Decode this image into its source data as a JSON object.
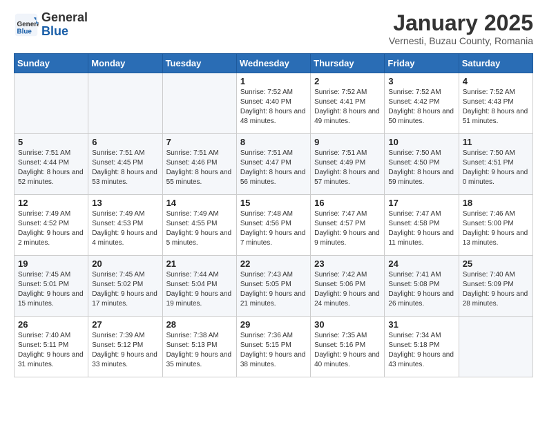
{
  "logo": {
    "general": "General",
    "blue": "Blue"
  },
  "title": "January 2025",
  "location": "Vernesti, Buzau County, Romania",
  "weekdays": [
    "Sunday",
    "Monday",
    "Tuesday",
    "Wednesday",
    "Thursday",
    "Friday",
    "Saturday"
  ],
  "weeks": [
    [
      {
        "day": "",
        "info": ""
      },
      {
        "day": "",
        "info": ""
      },
      {
        "day": "",
        "info": ""
      },
      {
        "day": "1",
        "info": "Sunrise: 7:52 AM\nSunset: 4:40 PM\nDaylight: 8 hours and 48 minutes."
      },
      {
        "day": "2",
        "info": "Sunrise: 7:52 AM\nSunset: 4:41 PM\nDaylight: 8 hours and 49 minutes."
      },
      {
        "day": "3",
        "info": "Sunrise: 7:52 AM\nSunset: 4:42 PM\nDaylight: 8 hours and 50 minutes."
      },
      {
        "day": "4",
        "info": "Sunrise: 7:52 AM\nSunset: 4:43 PM\nDaylight: 8 hours and 51 minutes."
      }
    ],
    [
      {
        "day": "5",
        "info": "Sunrise: 7:51 AM\nSunset: 4:44 PM\nDaylight: 8 hours and 52 minutes."
      },
      {
        "day": "6",
        "info": "Sunrise: 7:51 AM\nSunset: 4:45 PM\nDaylight: 8 hours and 53 minutes."
      },
      {
        "day": "7",
        "info": "Sunrise: 7:51 AM\nSunset: 4:46 PM\nDaylight: 8 hours and 55 minutes."
      },
      {
        "day": "8",
        "info": "Sunrise: 7:51 AM\nSunset: 4:47 PM\nDaylight: 8 hours and 56 minutes."
      },
      {
        "day": "9",
        "info": "Sunrise: 7:51 AM\nSunset: 4:49 PM\nDaylight: 8 hours and 57 minutes."
      },
      {
        "day": "10",
        "info": "Sunrise: 7:50 AM\nSunset: 4:50 PM\nDaylight: 8 hours and 59 minutes."
      },
      {
        "day": "11",
        "info": "Sunrise: 7:50 AM\nSunset: 4:51 PM\nDaylight: 9 hours and 0 minutes."
      }
    ],
    [
      {
        "day": "12",
        "info": "Sunrise: 7:49 AM\nSunset: 4:52 PM\nDaylight: 9 hours and 2 minutes."
      },
      {
        "day": "13",
        "info": "Sunrise: 7:49 AM\nSunset: 4:53 PM\nDaylight: 9 hours and 4 minutes."
      },
      {
        "day": "14",
        "info": "Sunrise: 7:49 AM\nSunset: 4:55 PM\nDaylight: 9 hours and 5 minutes."
      },
      {
        "day": "15",
        "info": "Sunrise: 7:48 AM\nSunset: 4:56 PM\nDaylight: 9 hours and 7 minutes."
      },
      {
        "day": "16",
        "info": "Sunrise: 7:47 AM\nSunset: 4:57 PM\nDaylight: 9 hours and 9 minutes."
      },
      {
        "day": "17",
        "info": "Sunrise: 7:47 AM\nSunset: 4:58 PM\nDaylight: 9 hours and 11 minutes."
      },
      {
        "day": "18",
        "info": "Sunrise: 7:46 AM\nSunset: 5:00 PM\nDaylight: 9 hours and 13 minutes."
      }
    ],
    [
      {
        "day": "19",
        "info": "Sunrise: 7:45 AM\nSunset: 5:01 PM\nDaylight: 9 hours and 15 minutes."
      },
      {
        "day": "20",
        "info": "Sunrise: 7:45 AM\nSunset: 5:02 PM\nDaylight: 9 hours and 17 minutes."
      },
      {
        "day": "21",
        "info": "Sunrise: 7:44 AM\nSunset: 5:04 PM\nDaylight: 9 hours and 19 minutes."
      },
      {
        "day": "22",
        "info": "Sunrise: 7:43 AM\nSunset: 5:05 PM\nDaylight: 9 hours and 21 minutes."
      },
      {
        "day": "23",
        "info": "Sunrise: 7:42 AM\nSunset: 5:06 PM\nDaylight: 9 hours and 24 minutes."
      },
      {
        "day": "24",
        "info": "Sunrise: 7:41 AM\nSunset: 5:08 PM\nDaylight: 9 hours and 26 minutes."
      },
      {
        "day": "25",
        "info": "Sunrise: 7:40 AM\nSunset: 5:09 PM\nDaylight: 9 hours and 28 minutes."
      }
    ],
    [
      {
        "day": "26",
        "info": "Sunrise: 7:40 AM\nSunset: 5:11 PM\nDaylight: 9 hours and 31 minutes."
      },
      {
        "day": "27",
        "info": "Sunrise: 7:39 AM\nSunset: 5:12 PM\nDaylight: 9 hours and 33 minutes."
      },
      {
        "day": "28",
        "info": "Sunrise: 7:38 AM\nSunset: 5:13 PM\nDaylight: 9 hours and 35 minutes."
      },
      {
        "day": "29",
        "info": "Sunrise: 7:36 AM\nSunset: 5:15 PM\nDaylight: 9 hours and 38 minutes."
      },
      {
        "day": "30",
        "info": "Sunrise: 7:35 AM\nSunset: 5:16 PM\nDaylight: 9 hours and 40 minutes."
      },
      {
        "day": "31",
        "info": "Sunrise: 7:34 AM\nSunset: 5:18 PM\nDaylight: 9 hours and 43 minutes."
      },
      {
        "day": "",
        "info": ""
      }
    ]
  ]
}
